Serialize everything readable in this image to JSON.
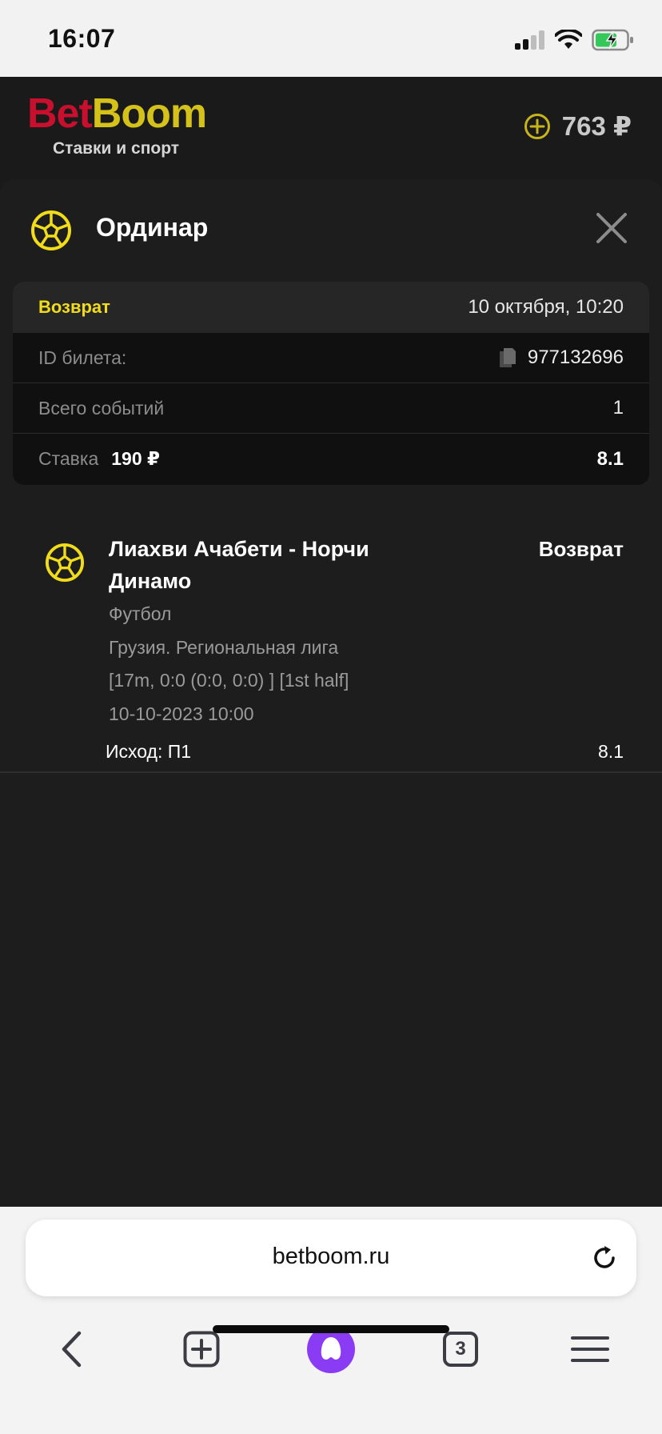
{
  "status_bar": {
    "time": "16:07"
  },
  "header": {
    "logo_bet": "Bet",
    "logo_boom": "Boom",
    "logo_subtitle": "Ставки и спорт",
    "balance": "763 ₽"
  },
  "bet": {
    "type": "Ординар",
    "status": "Возврат",
    "datetime": "10 октября, 10:20",
    "ticket_id_label": "ID билета:",
    "ticket_id": "977132696",
    "events_label": "Всего событий",
    "events_count": "1",
    "stake_label": "Ставка",
    "stake_amount": "190 ₽",
    "total_odds": "8.1"
  },
  "event": {
    "title": "Лиахви Ачабети - Норчи Динамо",
    "status": "Возврат",
    "sport": "Футбол",
    "league": "Грузия. Региональная лига",
    "score": "[17m, 0:0 (0:0, 0:0) ] [1st half]",
    "date": "10-10-2023 10:00",
    "outcome": "Исход: П1",
    "odds": "8.1"
  },
  "browser": {
    "url": "betboom.ru",
    "tabs_count": "3"
  },
  "colors": {
    "accent_yellow": "#f1dc1c",
    "brand_red": "#c8102e",
    "background": "#1a1a1a",
    "alice_purple": "#8a3cf5"
  }
}
